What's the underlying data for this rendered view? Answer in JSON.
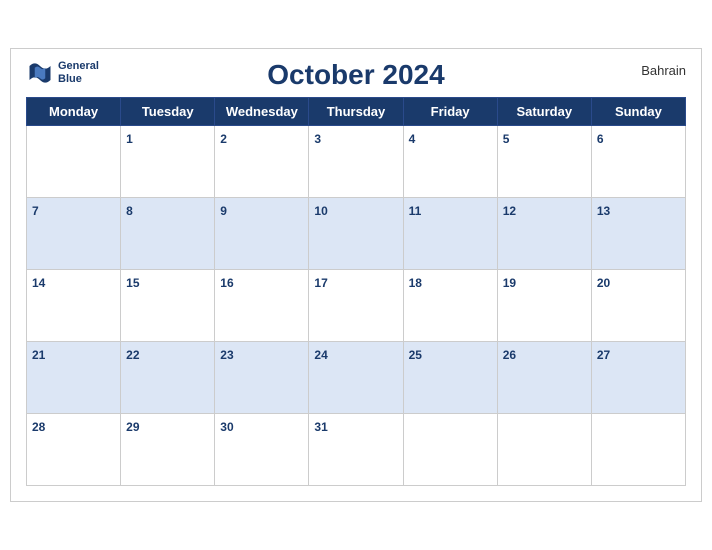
{
  "header": {
    "title": "October 2024",
    "country": "Bahrain",
    "logo_line1": "General",
    "logo_line2": "Blue"
  },
  "days_of_week": [
    "Monday",
    "Tuesday",
    "Wednesday",
    "Thursday",
    "Friday",
    "Saturday",
    "Sunday"
  ],
  "weeks": [
    [
      null,
      1,
      2,
      3,
      4,
      5,
      6
    ],
    [
      7,
      8,
      9,
      10,
      11,
      12,
      13
    ],
    [
      14,
      15,
      16,
      17,
      18,
      19,
      20
    ],
    [
      21,
      22,
      23,
      24,
      25,
      26,
      27
    ],
    [
      28,
      29,
      30,
      31,
      null,
      null,
      null
    ]
  ]
}
